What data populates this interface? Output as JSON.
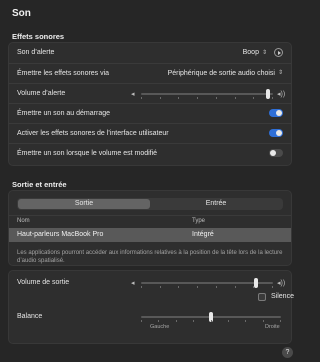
{
  "page": {
    "title": "Son"
  },
  "effects": {
    "title": "Effets sonores",
    "alert_sound": {
      "label": "Son d’alerte",
      "value": "Boop"
    },
    "output_via": {
      "label": "Émettre les effets sonores via",
      "value": "Périphérique de sortie audio choisi"
    },
    "alert_volume": {
      "label": "Volume d’alerte",
      "level": 0.96
    },
    "startup_sound": {
      "label": "Émettre un son au démarrage",
      "on": true
    },
    "ui_sounds": {
      "label": "Activer les effets sonores de l’interface utilisateur",
      "on": true
    },
    "volume_feedback": {
      "label": "Émettre un son lorsque le volume est modifié",
      "on": false
    }
  },
  "io": {
    "title": "Sortie et entrée",
    "tabs": [
      "Sortie",
      "Entrée"
    ],
    "active_tab": "Sortie",
    "columns": [
      "Nom",
      "Type"
    ],
    "devices": [
      {
        "name": "Haut-parleurs MacBook Pro",
        "type": "Intégré"
      }
    ],
    "note": "Les applications pourront accéder aux informations relatives à la position de la tête lors de la lecture d’audio spatialisé.",
    "output_volume": {
      "label": "Volume de sortie",
      "level": 0.87
    },
    "mute": {
      "label": "Silence",
      "checked": false
    },
    "balance": {
      "label": "Balance",
      "left": "Gauche",
      "right": "Droite",
      "level": 0.5
    }
  },
  "help": {
    "label": "?"
  },
  "colors": {
    "accent": "#2f6fd7",
    "background": "#262626",
    "panel": "#2e2e2e"
  }
}
